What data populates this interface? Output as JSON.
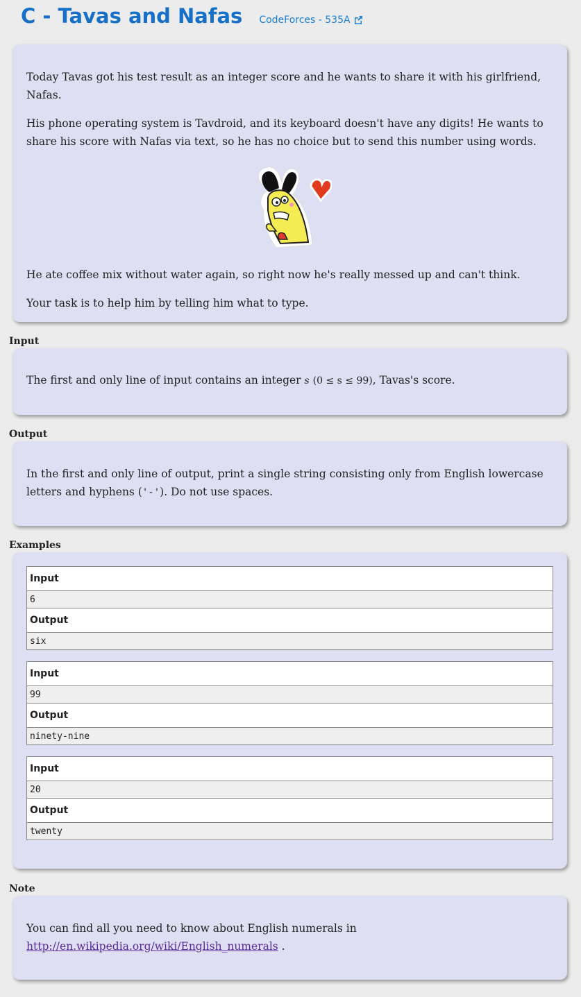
{
  "header": {
    "title": "C - Tavas and Nafas",
    "source_label": "CodeForces - 535A"
  },
  "statement": {
    "p1": "Today Tavas got his test result as an integer score and he wants to share it with his girlfriend, Nafas.",
    "p2": "His phone operating system is Tavdroid, and its keyboard doesn't have any digits! He wants to share his score with Nafas via text, so he has no choice but to send this number using words.",
    "p3": "He ate coffee mix without water again, so right now he's really messed up and can't think.",
    "p4": "Your task is to help him by telling him what to type."
  },
  "input_section": {
    "label": "Input",
    "text_before": "The first and only line of input contains an integer",
    "var": "s",
    "constraint": "(0 ≤ s ≤ 99)",
    "text_after": ", Tavas's score."
  },
  "output_section": {
    "label": "Output",
    "text_before": "In the first and only line of output, print a single string consisting only from English lowercase letters and hyphens (",
    "hyphen": "'-'",
    "text_after": "). Do not use spaces."
  },
  "examples": {
    "label": "Examples",
    "input_header": "Input",
    "output_header": "Output",
    "items": [
      {
        "input": "6",
        "output": "six"
      },
      {
        "input": "99",
        "output": "ninety-nine"
      },
      {
        "input": "20",
        "output": "twenty"
      }
    ]
  },
  "note": {
    "label": "Note",
    "text": "You can find all you need to know about English numerals in",
    "link": "http://en.wikipedia.org/wiki/English_numerals",
    "tail": " ."
  },
  "colors": {
    "title": "#1670c8",
    "card_bg": "#dedff2",
    "link_visited": "#5a2a96"
  }
}
